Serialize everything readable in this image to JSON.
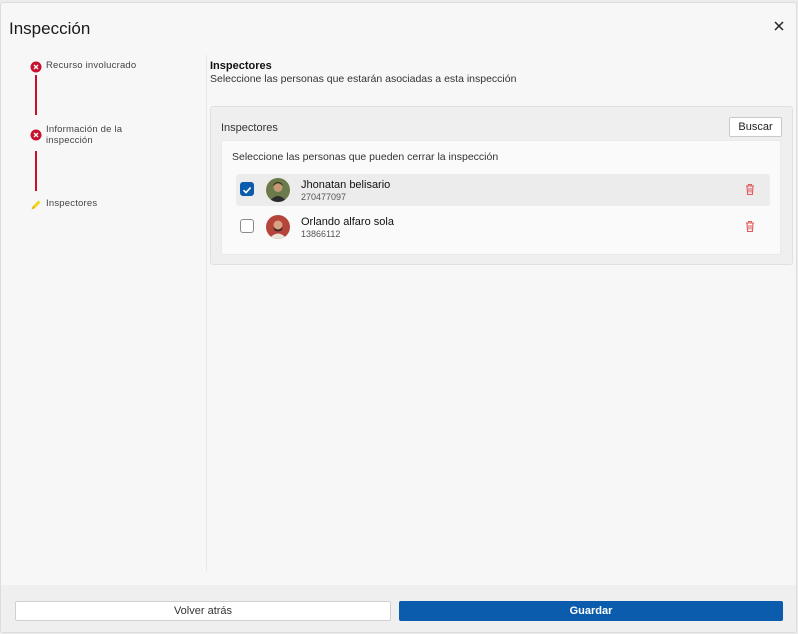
{
  "dialog": {
    "title": "Inspección"
  },
  "stepper": {
    "steps": [
      {
        "label": "Recurso involucrado",
        "state": "error",
        "icon": "error-icon"
      },
      {
        "label": "Información de la inspección",
        "state": "error",
        "icon": "error-icon"
      },
      {
        "label": "Inspectores",
        "state": "editing",
        "icon": "pencil-icon"
      }
    ],
    "error_color": "#c8102e",
    "editing_color": "#f2d21b"
  },
  "section": {
    "title": "Inspectores",
    "subtitle": "Seleccione las personas que estarán asociadas a esta inspección"
  },
  "panel": {
    "label": "Inspectores",
    "search_button": "Buscar",
    "instruction": "Seleccione las personas que pueden cerrar la inspección",
    "people": [
      {
        "name": "Jhonatan belisario",
        "id": "270477097",
        "checked": true
      },
      {
        "name": "Orlando alfaro sola",
        "id": "13866112",
        "checked": false
      }
    ]
  },
  "footer": {
    "back_button": "Volver atrás",
    "save_button": "Guardar"
  },
  "colors": {
    "primary": "#0b5cad",
    "danger": "#e05a5a"
  }
}
